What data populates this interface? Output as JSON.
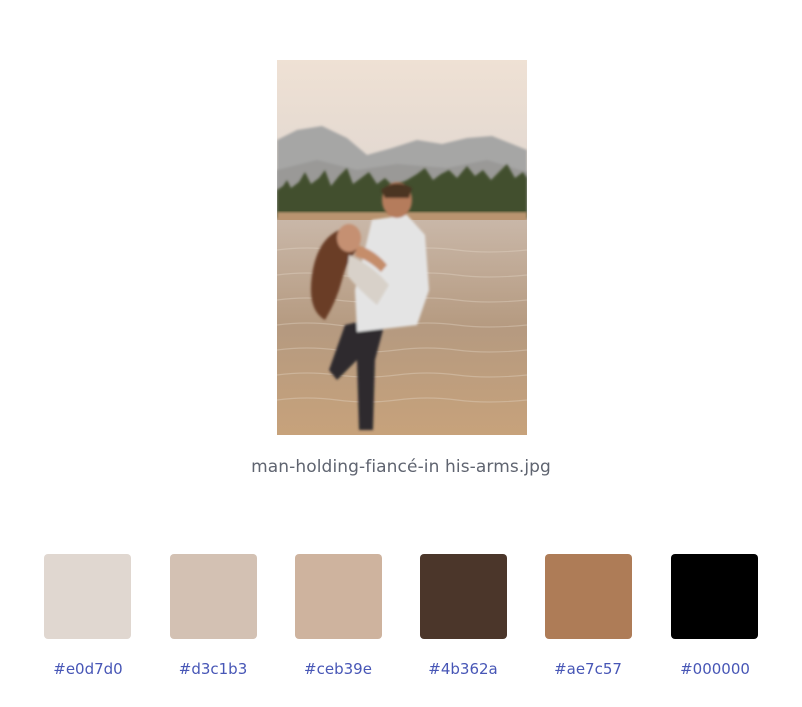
{
  "image": {
    "filename": "man-holding-fiancé-in his-arms.jpg",
    "alt": "man holding fiancé in his arms by a lake"
  },
  "palette": [
    {
      "hex": "#e0d7d0",
      "color": "#e0d7d0"
    },
    {
      "hex": "#d3c1b3",
      "color": "#d3c1b3"
    },
    {
      "hex": "#ceb39e",
      "color": "#ceb39e"
    },
    {
      "hex": "#4b362a",
      "color": "#4b362a"
    },
    {
      "hex": "#ae7c57",
      "color": "#ae7c57"
    },
    {
      "hex": "#000000",
      "color": "#000000"
    }
  ]
}
